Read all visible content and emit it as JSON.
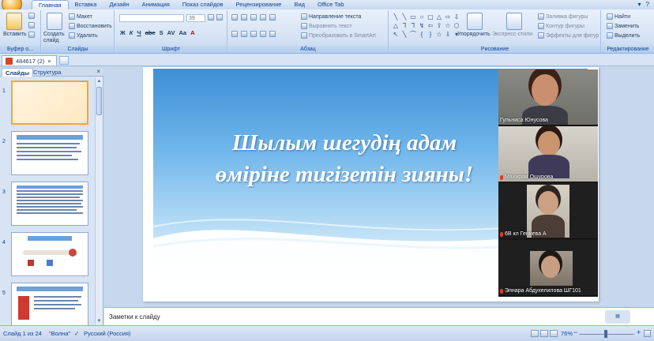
{
  "ribbon_tabs": [
    "Главная",
    "Вставка",
    "Дизайн",
    "Анимация",
    "Показ слайдов",
    "Рецензирование",
    "Вид",
    "Office Tab"
  ],
  "active_tab": "Главная",
  "clipboard": {
    "paste": "Вставить",
    "label": "Буфер о..."
  },
  "slides_group": {
    "create": "Создать слайд",
    "layout": "Макет",
    "restore": "Восстановить",
    "delete": "Удалить",
    "label": "Слайды"
  },
  "font_group": {
    "font_value": "",
    "size_value": "39",
    "label": "Шрифт"
  },
  "paragraph_group": {
    "text_direction": "Направление текста",
    "align_text": "Выровнять текст",
    "smartart": "Преобразовать в SmartArt",
    "label": "Абзац"
  },
  "drawing_group": {
    "arrange": "Упорядочить",
    "quick_styles": "Экспресс-стили",
    "fill": "Заливка фигуры",
    "outline": "Контур фигуры",
    "effects": "Эффекты для фигур",
    "label": "Рисование"
  },
  "editing_group": {
    "find": "Найти",
    "replace": "Заменить",
    "select": "Выделить",
    "label": "Редактирование"
  },
  "doc_tab": {
    "title": "484617 (2)"
  },
  "left_panel": {
    "tab_slides": "Слайды",
    "tab_outline": "Структура",
    "close": "×"
  },
  "thumbnails": [
    {
      "num": "1"
    },
    {
      "num": "2"
    },
    {
      "num": "3"
    },
    {
      "num": "4"
    },
    {
      "num": "5"
    }
  ],
  "slide": {
    "title_line1": "Шылым шегудің адам",
    "title_line2": "өміріне тигізетін зияны!"
  },
  "participants": [
    {
      "name": "Гульнисa Юнусова",
      "muted": false
    },
    {
      "name": "Махирям Ошурова",
      "muted": true
    },
    {
      "name": "6В кл Гениева А",
      "muted": true
    },
    {
      "name": "Элнара Абдухелилова ШГ101",
      "muted": true
    }
  ],
  "notes": {
    "placeholder": "Заметки к слайду"
  },
  "status": {
    "slide_pos": "Слайд 1 из 24",
    "theme": "\"Волна\"",
    "language": "Русский (Россия)",
    "zoom": "76%"
  },
  "colors": {
    "ribbon": "#d4e2f4",
    "slide_top": "#3e8fd6",
    "accent": "#f3a53d"
  }
}
